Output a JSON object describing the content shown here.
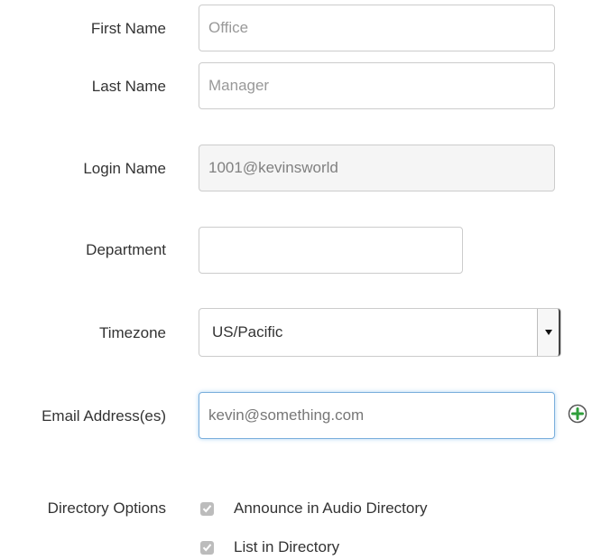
{
  "form": {
    "first_name": {
      "label": "First Name",
      "value": "Office"
    },
    "last_name": {
      "label": "Last Name",
      "value": "Manager"
    },
    "login_name": {
      "label": "Login Name",
      "value": "1001@kevinsworld"
    },
    "department": {
      "label": "Department",
      "value": ""
    },
    "timezone": {
      "label": "Timezone",
      "selected": "US/Pacific"
    },
    "email": {
      "label": "Email Address(es)",
      "value": "kevin@something.com"
    },
    "directory_options": {
      "label": "Directory Options",
      "options": [
        {
          "label": "Announce in Audio Directory",
          "checked": true
        },
        {
          "label": "List in Directory",
          "checked": true
        }
      ]
    }
  },
  "icons": {
    "add_email": "plus-circle-icon",
    "select_arrow": "caret-down-icon",
    "checkbox_check": "checkmark-icon"
  },
  "colors": {
    "add_icon_green": "#2e9e3a",
    "focus_border": "#7aaedc",
    "checkbox_fill": "#bcbcbc"
  }
}
